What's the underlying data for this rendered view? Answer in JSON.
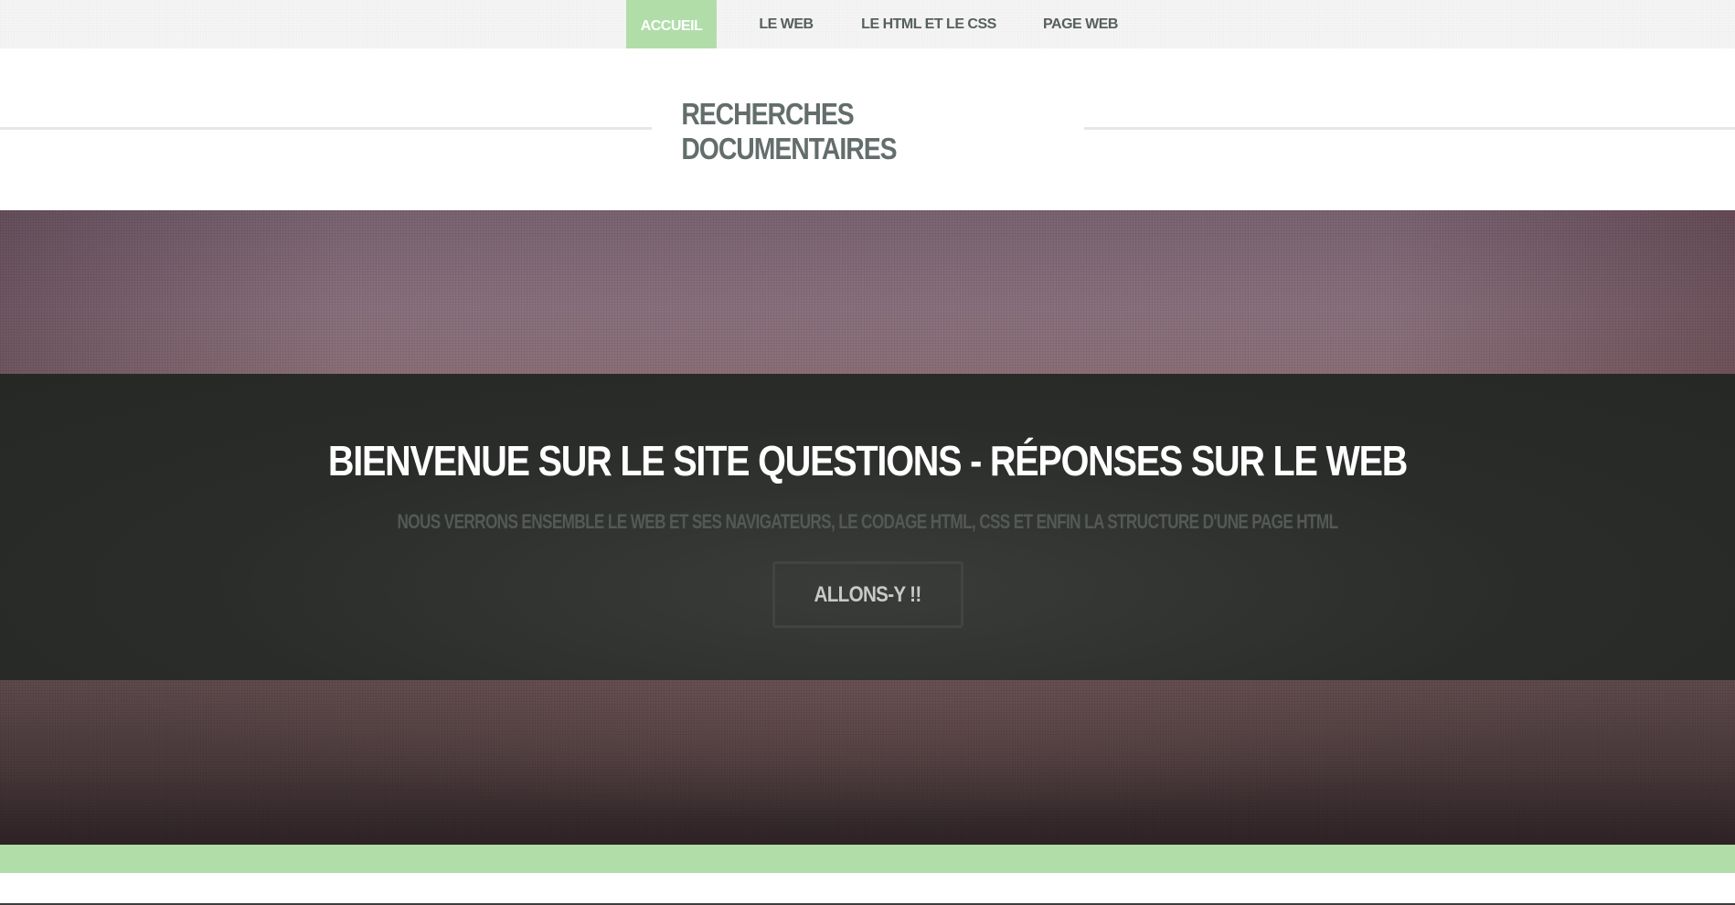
{
  "nav": {
    "items": [
      {
        "label": "ACCUEIL",
        "active": true
      },
      {
        "label": "LE WEB",
        "active": false
      },
      {
        "label": "LE HTML ET LE CSS",
        "active": false
      },
      {
        "label": "PAGE WEB",
        "active": false
      }
    ]
  },
  "section": {
    "title": "RECHERCHES DOCUMENTAIRES"
  },
  "hero": {
    "heading": "BIENVENUE SUR LE SITE QUESTIONS - RÉPONSES SUR LE WEB",
    "subtitle": "NOUS VERRONS ENSEMBLE LE WEB ET SES NAVIGATEURS, LE CODAGE HTML, CSS ET ENFIN LA STRUCTURE D'UNE PAGE HTML",
    "button_label": "ALLONS-Y !!"
  },
  "colors": {
    "accent_green": "#b1dda9",
    "hero_dark": "#2a2c2a",
    "title_gray": "#636e6c"
  }
}
